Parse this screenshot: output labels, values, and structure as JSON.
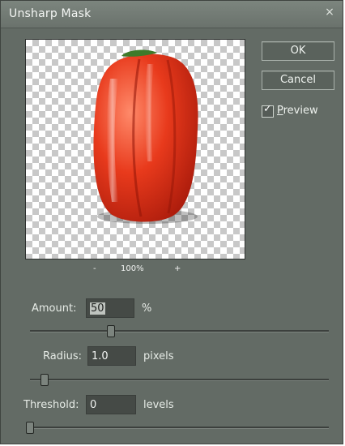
{
  "dialog": {
    "title": "Unsharp Mask",
    "close_glyph": "×"
  },
  "preview": {
    "zoom": "100%",
    "zoom_out": "-",
    "zoom_in": "+"
  },
  "buttons": {
    "ok": "OK",
    "cancel": "Cancel"
  },
  "preview_checkbox": {
    "label_first": "P",
    "label_rest": "review",
    "checked": true,
    "mark": "✓"
  },
  "amount": {
    "label": "Amount:",
    "value": "50",
    "unit": "%",
    "slider_fraction": 0.27
  },
  "radius": {
    "label": "Radius:",
    "value": "1.0",
    "unit": "pixels",
    "slider_fraction": 0.05
  },
  "threshold": {
    "label": "Threshold:",
    "value": "0",
    "unit": "levels",
    "slider_fraction": 0.0
  }
}
